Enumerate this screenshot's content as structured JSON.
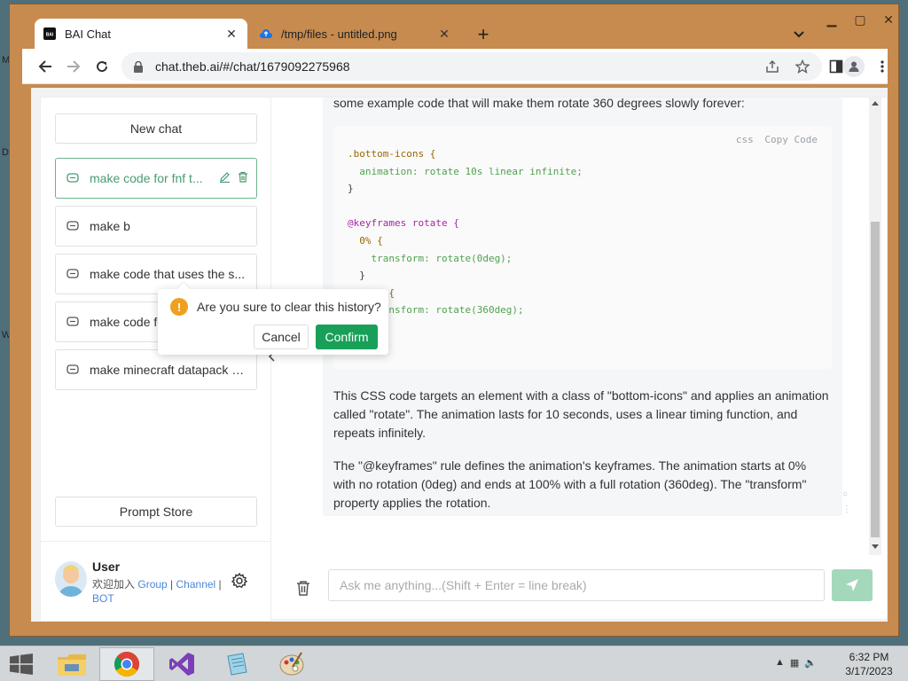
{
  "browser": {
    "tabs": [
      {
        "title": "BAI Chat",
        "favicon": "bai-logo"
      },
      {
        "title": "/tmp/files - untitled.png",
        "favicon": "cloud-icon"
      }
    ],
    "url": "chat.theb.ai/#/chat/1679092275968"
  },
  "sidebar": {
    "new_chat": "New chat",
    "history": [
      {
        "title": "make code for fnf t..."
      },
      {
        "title": "make b"
      },
      {
        "title": "make code that uses the s..."
      },
      {
        "title": "make code for the startup ..."
      },
      {
        "title": "make minecraft datapack c..."
      }
    ],
    "prompt_store": "Prompt Store",
    "user": {
      "name": "User",
      "desc_prefix": "欢迎加入",
      "links": [
        "Group",
        "Channel",
        "BOT"
      ],
      "separator": " | "
    }
  },
  "popconfirm": {
    "message": "Are you sure to clear this history?",
    "cancel": "Cancel",
    "confirm": "Confirm"
  },
  "chat": {
    "intro": "some example code that will make them rotate 360 degrees slowly forever:",
    "code": {
      "lang": "css",
      "copy": "Copy Code",
      "lines": [
        ".bottom-icons {",
        "  animation: rotate 10s linear infinite;",
        "}",
        "",
        "@keyframes rotate {",
        "  0% {",
        "    transform: rotate(0deg);",
        "  }",
        "  100% {",
        "    transform: rotate(360deg);",
        "  }",
        "}"
      ]
    },
    "para1": "This CSS code targets an element with a class of \"bottom-icons\" and applies an animation called \"rotate\". The animation lasts for 10 seconds, uses a linear timing function, and repeats infinitely.",
    "para2": "The \"@keyframes\" rule defines the animation's keyframes. The animation starts at 0% with no rotation (0deg) and ends at 100% with a full rotation (360deg). The \"transform\" property applies the rotation.",
    "input_placeholder": "Ask me anything...(Shift + Enter = line break)"
  },
  "taskbar": {
    "clock_time": "6:32 PM",
    "clock_date": "3/17/2023",
    "apps": [
      "file-explorer-icon",
      "chrome-icon",
      "visual-studio-icon",
      "notepad-icon",
      "paint-icon"
    ]
  },
  "colors": {
    "accent": "#18a058",
    "warning": "#f0a020",
    "window_frame": "#c78b4f"
  }
}
